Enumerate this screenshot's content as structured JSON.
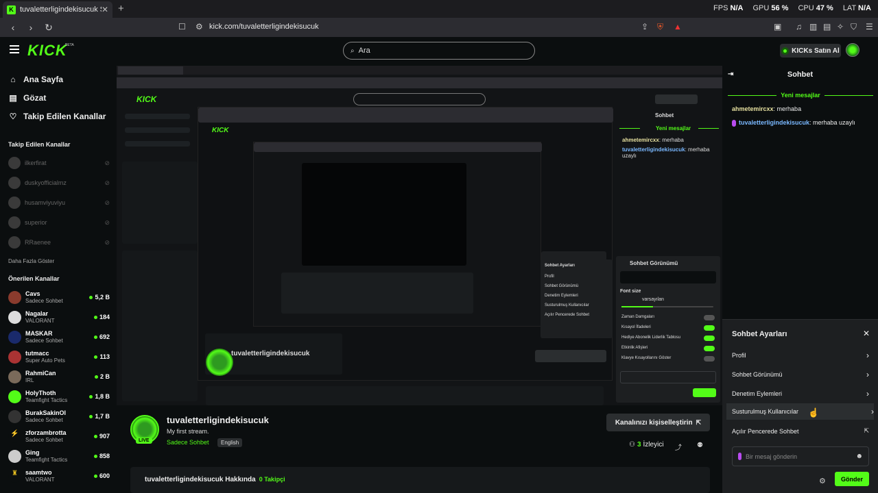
{
  "browser": {
    "tab_title": "tuvaletterligindekisucuk Stream",
    "url": "kick.com/tuvaletterligindekisucuk",
    "stats": [
      {
        "label": "FPS",
        "value": "N/A"
      },
      {
        "label": "GPU",
        "value": "56 %"
      },
      {
        "label": "CPU",
        "value": "47 %"
      },
      {
        "label": "LAT",
        "value": "N/A"
      }
    ]
  },
  "header": {
    "logo": "KICK",
    "beta": "BETA",
    "search_placeholder": "Ara",
    "kicks_button": "KICKs Satın Al"
  },
  "sidebar": {
    "nav": [
      {
        "label": "Ana Sayfa",
        "icon": "home-icon"
      },
      {
        "label": "Gözat",
        "icon": "browse-icon"
      },
      {
        "label": "Takip Edilen Kanallar",
        "icon": "heart-icon"
      }
    ],
    "followed_title": "Takip Edilen Kanallar",
    "followed": [
      "ilkerfirat",
      "duskyofficialmz",
      "husamviyuviyu",
      "superior",
      "RRaenee"
    ],
    "show_more": "Daha Fazla Göster",
    "recommended_title": "Önerilen Kanallar",
    "recommended": [
      {
        "name": "Cavs",
        "category": "Sadece Sohbet",
        "viewers": "5,2 B"
      },
      {
        "name": "Nagalar",
        "category": "VALORANT",
        "viewers": "184"
      },
      {
        "name": "MASKAR",
        "category": "Sadece Sohbet",
        "viewers": "692"
      },
      {
        "name": "tutmacc",
        "category": "Super Auto Pets",
        "viewers": "113"
      },
      {
        "name": "RahmiCan",
        "category": "IRL",
        "viewers": "2 B"
      },
      {
        "name": "HolyThoth",
        "category": "Teamfight Tactics",
        "viewers": "1,8 B"
      },
      {
        "name": "BurakSakinOl",
        "category": "Sadece Sohbet",
        "viewers": "1,7 B"
      },
      {
        "name": "zforzambrotta",
        "category": "Sadece Sohbet",
        "viewers": "907"
      },
      {
        "name": "Ging",
        "category": "Teamfight Tactics",
        "viewers": "858"
      },
      {
        "name": "saamtwo",
        "category": "VALORANT",
        "viewers": "600"
      }
    ]
  },
  "stream": {
    "channel": "tuvaletterligindekisucuk",
    "title": "My first stream.",
    "category": "Sadece Sohbet",
    "language": "English",
    "live": "LIVE",
    "customize_button": "Kanalınızı kişiselleştirin",
    "viewers_count": "3",
    "viewers_label": "İzleyici",
    "about_title": "tuvaletterligindekisucuk Hakkında",
    "followers": "0 Takipçi"
  },
  "chat": {
    "title": "Sohbet",
    "new_messages": "Yeni mesajlar",
    "messages": [
      {
        "user": "ahmetemircxx",
        "text": ": merhaba"
      },
      {
        "user": "tuvaletterligindekisucuk",
        "text": ": merhaba uzaylı"
      }
    ],
    "settings": {
      "title": "Sohbet Ayarları",
      "items": [
        "Profil",
        "Sohbet Görünümü",
        "Denetim Eylemleri",
        "Susturulmuş Kullanıcılar",
        "Açılır Pencerede Sohbet"
      ]
    },
    "input_placeholder": "Bir mesaj gönderin",
    "send": "Gönder"
  },
  "nested_panel": {
    "title": "Sohbet Görünümü",
    "font_size_label": "Font size",
    "font_option_default": "varsayılan",
    "toggles": [
      "Zaman Damgaları",
      "Kısayol İfadeleri",
      "Hediye Abonelik Liderlik Tablosu",
      "Etkinlik Afişleri",
      "Klavye Kısayollarını Göster"
    ],
    "settings_items": [
      "Profil",
      "Sohbet Görünümü",
      "Denetim Eylemleri",
      "Susturulmuş Kullanıcılar",
      "Açılır Pencerede Sohbet"
    ]
  },
  "colors": {
    "accent": "#53fc18",
    "bg": "#0b0e0f",
    "panel": "#1d1f21"
  }
}
